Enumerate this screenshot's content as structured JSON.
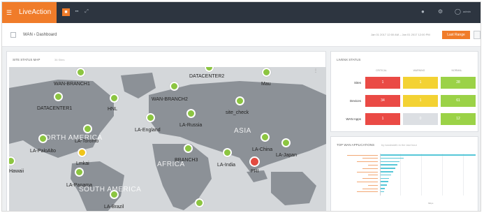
{
  "topbar": {
    "menu_icon": "hamburger-icon",
    "app_name": "LiveAction",
    "icons": [
      "home-icon",
      "grid-icon",
      "expand-icon"
    ],
    "right_icons": [
      "alert-icon",
      "settings-icon",
      "user-icon"
    ],
    "user_text": "admin"
  },
  "breadcrumb": {
    "text": "WAN › Dashboard",
    "date_range": "Jan 01 2017 12:00 AM – Jan 01 2017 12:00 PM",
    "action_label": "Last Range"
  },
  "map_panel": {
    "title": "SITE STATUS MAP",
    "subtitle": "36 Sites",
    "regions": [
      "NORTH AMERICA",
      "ASIA",
      "AFRICA",
      "SOUTH AMERICA"
    ],
    "pins": [
      {
        "label": "WAN-BRANCH1",
        "status": "ok"
      },
      {
        "label": "DATACENTER1",
        "status": "ok"
      },
      {
        "label": "DATACENTER2",
        "status": "ok"
      },
      {
        "label": "Mau",
        "status": "ok"
      },
      {
        "label": "WAN-BRANCH2",
        "status": "ok"
      },
      {
        "label": "HNL",
        "status": "ok"
      },
      {
        "label": "site_check",
        "status": "ok"
      },
      {
        "label": "LA-Russia",
        "status": "ok"
      },
      {
        "label": "LA-England",
        "status": "ok"
      },
      {
        "label": "LA-Toronto",
        "status": "ok"
      },
      {
        "label": "LA-PaloAlto",
        "status": "ok"
      },
      {
        "label": "LA-China",
        "status": "ok"
      },
      {
        "label": "LA-Japan",
        "status": "ok"
      },
      {
        "label": "Lmkai",
        "status": "warn"
      },
      {
        "label": "BRANCH3",
        "status": "ok"
      },
      {
        "label": "LA-India",
        "status": "ok"
      },
      {
        "label": "PRI",
        "status": "crit"
      },
      {
        "label": "Hawaii",
        "status": "ok"
      },
      {
        "label": "LA-Panama",
        "status": "ok"
      },
      {
        "label": "LA-Brazil",
        "status": "ok"
      },
      {
        "label": "",
        "status": "ok"
      }
    ]
  },
  "status_panel": {
    "title": "LIVENX STATUS",
    "columns": [
      "CRITICAL",
      "WARNING",
      "NORMAL"
    ],
    "rows": [
      {
        "label": "Sites",
        "values": [
          "1",
          "1",
          "28"
        ],
        "colors": [
          "red",
          "yellow",
          "green"
        ]
      },
      {
        "label": "Devices",
        "values": [
          "34",
          "1",
          "61"
        ],
        "colors": [
          "red",
          "yellow",
          "green"
        ]
      },
      {
        "label": "WAN Apps",
        "values": [
          "1",
          "0",
          "12"
        ],
        "colors": [
          "red",
          "gray",
          "green"
        ]
      }
    ]
  },
  "apps_panel": {
    "title": "TOP WAN APPLICATIONS",
    "subtitle": "by bandwidth in the last hour",
    "chart_data": {
      "type": "bar",
      "orientation": "horizontal",
      "categories": [
        "",
        "",
        "",
        "",
        "",
        "",
        "",
        "",
        "",
        "",
        "",
        ""
      ],
      "values": [
        90,
        22,
        18,
        16,
        14,
        12,
        10,
        8,
        7,
        6,
        4,
        3
      ],
      "xlabel": "Mbps",
      "color": "#56c7d8"
    }
  }
}
